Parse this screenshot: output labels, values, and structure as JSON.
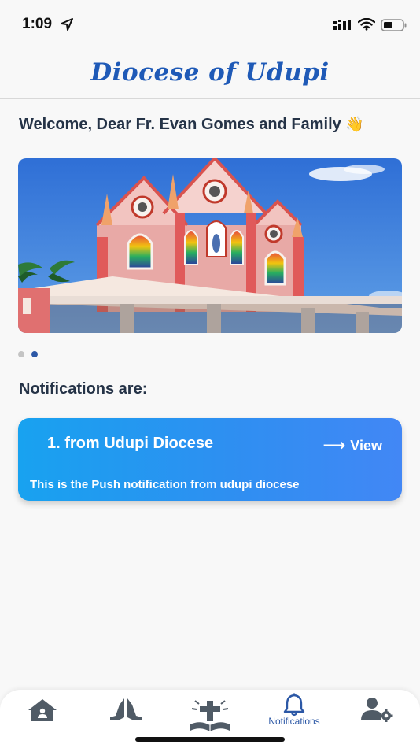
{
  "status_bar": {
    "time": "1:09",
    "icons": [
      "location-arrow-icon",
      "signal-icon",
      "wifi-icon",
      "battery-icon"
    ]
  },
  "header": {
    "title": "Diocese of Udupi"
  },
  "welcome": {
    "text": "Welcome, Dear Fr. Evan Gomes and Family",
    "emoji": "👋"
  },
  "carousel": {
    "image_subject": "church-building",
    "slide_count": 2,
    "active_index": 1
  },
  "notifications": {
    "heading": "Notifications are:",
    "items": [
      {
        "title": "1. from Udupi Diocese",
        "view_label": "View",
        "body": "This is the Push notification from udupi diocese"
      }
    ]
  },
  "tabbar": {
    "tabs": [
      {
        "icon": "home-icon",
        "label": ""
      },
      {
        "icon": "praying-hands-icon",
        "label": ""
      },
      {
        "icon": "bible-cross-icon",
        "label": ""
      },
      {
        "icon": "bell-icon",
        "label": "Notifications",
        "active": true
      },
      {
        "icon": "user-settings-icon",
        "label": ""
      }
    ]
  },
  "colors": {
    "brand_blue": "#1f5ab7",
    "active_tab": "#2c58a6",
    "text_dark": "#253347",
    "card_gradient_start": "#18a2f0",
    "card_gradient_end": "#4287f5",
    "icon_gray": "#505b66"
  }
}
